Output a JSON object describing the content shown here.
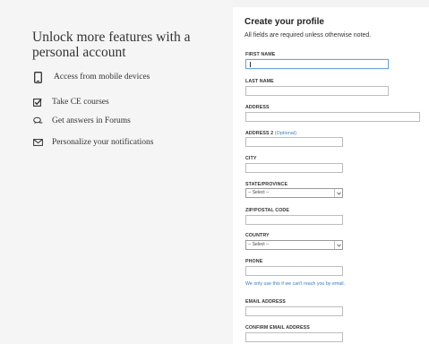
{
  "promo": {
    "title": "Unlock more features with a personal account",
    "benefits": [
      {
        "icon": "mobile-phone-icon",
        "label": "Access from mobile devices"
      },
      {
        "icon": "checkbox-icon",
        "label": "Take CE courses"
      },
      {
        "icon": "chat-bubbles-icon",
        "label": "Get answers in Forums"
      },
      {
        "icon": "envelope-icon",
        "label": "Personalize your notifications"
      }
    ]
  },
  "form": {
    "title": "Create your profile",
    "note": "All fields are required unless otherwise noted.",
    "first_name_label": "FIRST NAME",
    "first_name_value": "",
    "last_name_label": "LAST NAME",
    "address_label": "ADDRESS",
    "address2_label": "ADDRESS 2",
    "address2_optional": "(Optional)",
    "city_label": "CITY",
    "state_label": "STATE/PROVINCE",
    "state_selected": "-- Select --",
    "zip_label": "ZIP/POSTAL CODE",
    "country_label": "COUNTRY",
    "country_selected": "-- Select --",
    "phone_label": "PHONE",
    "phone_help": "We only use this if we can't reach you by email.",
    "email_label": "EMAIL ADDRESS",
    "confirm_email_label": "CONFIRM EMAIL ADDRESS"
  }
}
